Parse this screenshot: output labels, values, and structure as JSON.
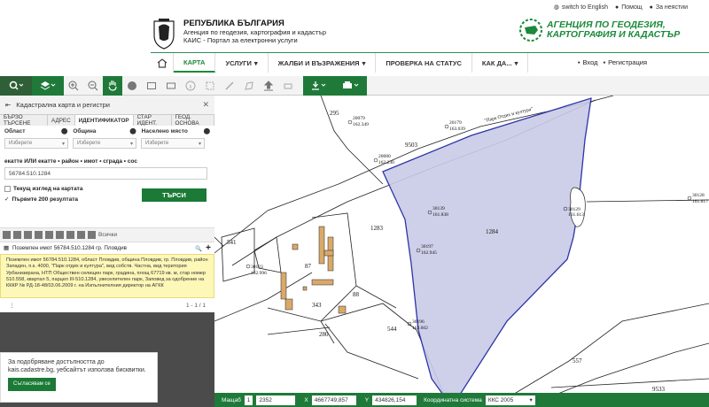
{
  "header": {
    "republic": "РЕПУБЛИКА БЪЛГАРИЯ",
    "agency_line": "Агенция по геодезия, картография и кадастър",
    "portal_line": "КАИС - Портал за електронни услуги",
    "agency_logo_line1": "АГЕНЦИЯ ПО ГЕОДЕЗИЯ,",
    "agency_logo_line2": "КАРТОГРАФИЯ И КАДАСТЪР",
    "links": [
      "switch to English",
      "Помощ",
      "За неястии"
    ]
  },
  "nav": {
    "items": [
      "КАРТА",
      "УСЛУГИ",
      "ЖАЛБИ И ВЪЗРАЖЕНИЯ",
      "ПРОВЕРКА НА СТАТУС",
      "КАК ДА..."
    ],
    "login": "Вход",
    "register": "Регистрация"
  },
  "panel": {
    "title": "Кадастрална карта и регистри",
    "tabs": [
      "БЪРЗО ТЪРСЕНЕ",
      "АДРЕС",
      "ИДЕНТИФИКАТОР",
      "СТАР ИДЕНТ.",
      "ГЕОД. ОСНОВА"
    ],
    "labels": [
      "Област",
      "Община",
      "Населено място"
    ],
    "selects": [
      "Изберете",
      "Изберете",
      "Изберете"
    ],
    "hint": "екатте ИЛИ екатте • район • имот • сграда • сос",
    "id_value": "56784.510.1284",
    "check1": "Текущ изглед на картата",
    "check2": "Първите 200 резултата",
    "search": "ТЪРСИ",
    "all": "Всички",
    "result_title": "Поземлен имот 56784.510.1284 гр. Пловдив",
    "result_text": "Поземлен имот 56784.510.1284, област Пловдив, община Пловдив, гр. Пловдив, район Западен, п.к. 4000, \"Парк отдих и култура\", вид собств. Частна, вид територия Урбанизирана, НТП Обществен селищен парк, градина, площ 67719 кв. м, стар номер 510.558, квартал 5, парцел III-510.1284, увеселителен парк, Заповед за одобрение на КККР № РД-18-48/03.06.2009 г. на Изпълнителния директор на АГКК",
    "pager": "1 - 1 / 1"
  },
  "cookie": {
    "text": "За подобряване достъпността до kais.cadastre.bg, уебсайтът използва бисквитки.",
    "button": "Съгласявам се"
  },
  "map": {
    "road_label": "\"Парк Отдих и култура\"",
    "labels": {
      "p295": "295",
      "p9503": "9503",
      "p1283": "1283",
      "p1284": "1284",
      "p541": "541",
      "p87": "87",
      "p88": "88",
      "p343": "343",
      "p544": "544",
      "p557": "557",
      "p280": "280",
      "p9533": "9533"
    },
    "points": [
      "2007|162.349",
      "20080|162.230",
      "20179|163.039",
      "30139|161.838",
      "30197|162.945",
      "30129|161.613",
      "30123|162.996",
      "30196|162.602",
      "30128|161.817",
      "30114|162.585"
    ]
  },
  "status": {
    "scale_label": "Мащаб",
    "scale_one": "1",
    "scale_value": "2352",
    "x_label": "X",
    "x_value": "4667749,857",
    "y_label": "Y",
    "y_value": "434826,154",
    "cs_label": "Координатна система",
    "cs_value": "ККС 2005"
  }
}
